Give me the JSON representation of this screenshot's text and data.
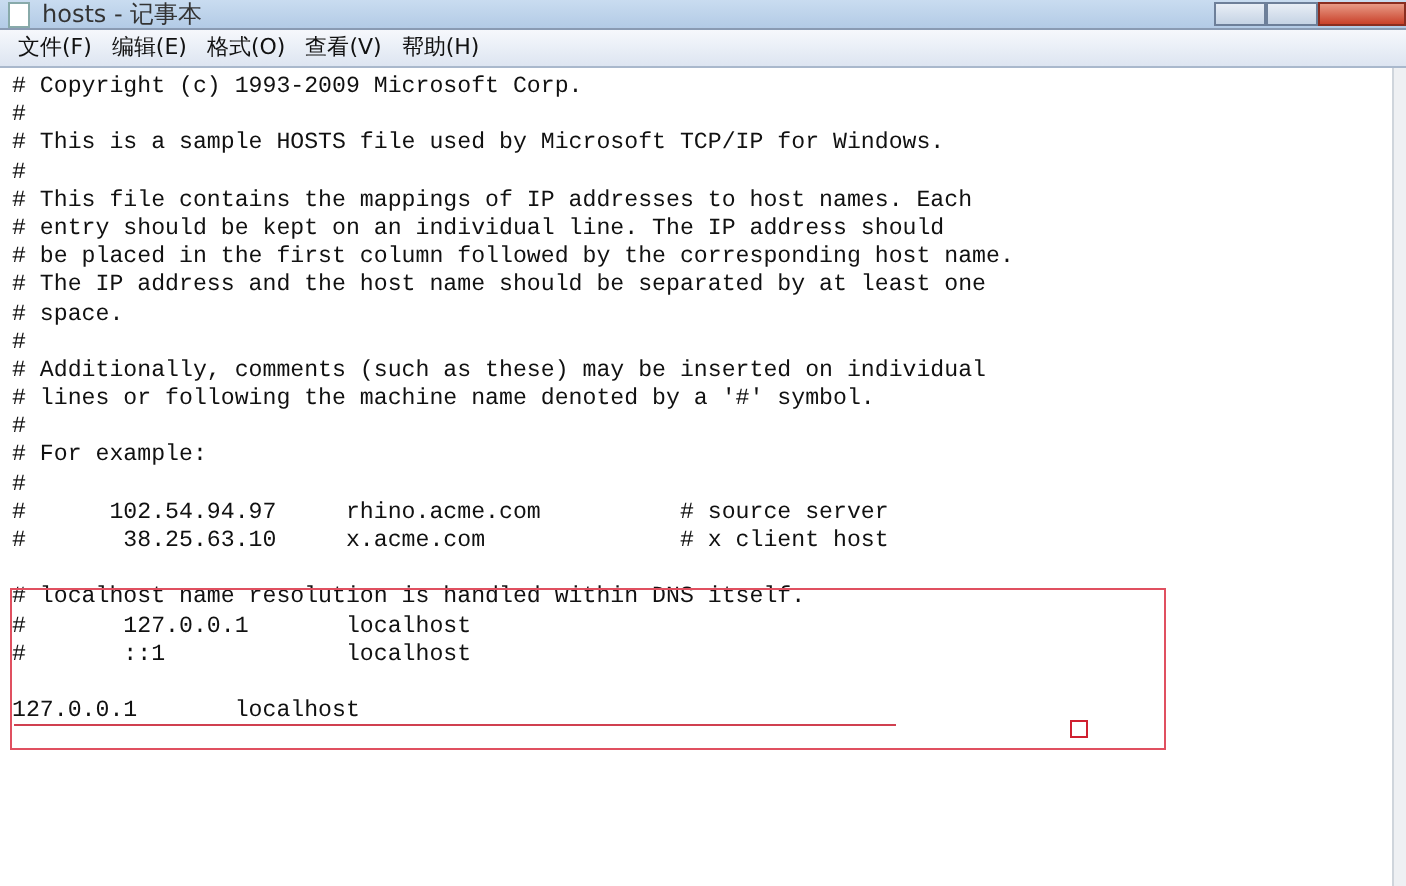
{
  "window": {
    "title": "hosts - 记事本"
  },
  "menu": [
    "文件(F)",
    "编辑(E)",
    "格式(O)",
    "查看(V)",
    "帮助(H)"
  ],
  "paragraphs": [
    [
      "# Copyright (c) 1993-2009 Microsoft Corp.",
      "#",
      "# This is a sample HOSTS file used by Microsoft TCP/IP for Windows.",
      "#",
      "# This file contains the mappings of IP addresses to host names. Each",
      "# entry should be kept on an individual line. The IP address should",
      "# be placed in the first column followed by the corresponding host name.",
      "# The IP address and the host name should be separated by at least one",
      "# space.",
      "#",
      "# Additionally, comments (such as these) may be inserted on individual",
      "# lines or following the machine name denoted by a '#' symbol.",
      "#",
      "# For example:",
      "#",
      "#      102.54.94.97     rhino.acme.com          # source server",
      "#       38.25.63.10     x.acme.com              # x client host"
    ],
    [
      "# localhost name resolution is handled within DNS itself.",
      "#       127.0.0.1       localhost",
      "#       ::1             localhost"
    ],
    [
      "127.0.0.1       localhost"
    ]
  ]
}
